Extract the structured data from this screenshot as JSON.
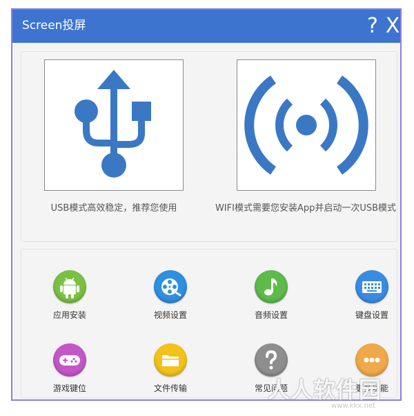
{
  "window": {
    "title": "Screen投屏",
    "help_label": "?",
    "close_label": "X"
  },
  "modes": {
    "usb": {
      "icon": "usb-icon",
      "caption": "USB模式高效稳定，推荐您使用"
    },
    "wifi": {
      "icon": "wifi-signal-icon",
      "caption": "WIFI模式需要您安装App并启动一次USB模式"
    }
  },
  "tools": [
    {
      "label": "应用安装",
      "icon": "android-icon",
      "color": "#7ac043"
    },
    {
      "label": "视频设置",
      "icon": "film-reel-icon",
      "color": "#2f8fe0"
    },
    {
      "label": "音频设置",
      "icon": "music-note-icon",
      "color": "#5dbb4a"
    },
    {
      "label": "键盘设置",
      "icon": "keyboard-icon",
      "color": "#3a8be2"
    },
    {
      "label": "游戏键位",
      "icon": "gamepad-icon",
      "color": "#c456c8"
    },
    {
      "label": "文件传输",
      "icon": "folder-icon",
      "color": "#f2c21b"
    },
    {
      "label": "常见问题",
      "icon": "question-icon",
      "color": "#8e8e8e"
    },
    {
      "label": "更多功能",
      "icon": "more-dots-icon",
      "color": "#f0a94a"
    }
  ],
  "watermark": {
    "text": "人人软件园",
    "url": "www.kkx.net"
  },
  "colors": {
    "titlebar": "#3d74cf",
    "accent_icon": "#3b78c4",
    "window_border": "#8e7fe0"
  }
}
